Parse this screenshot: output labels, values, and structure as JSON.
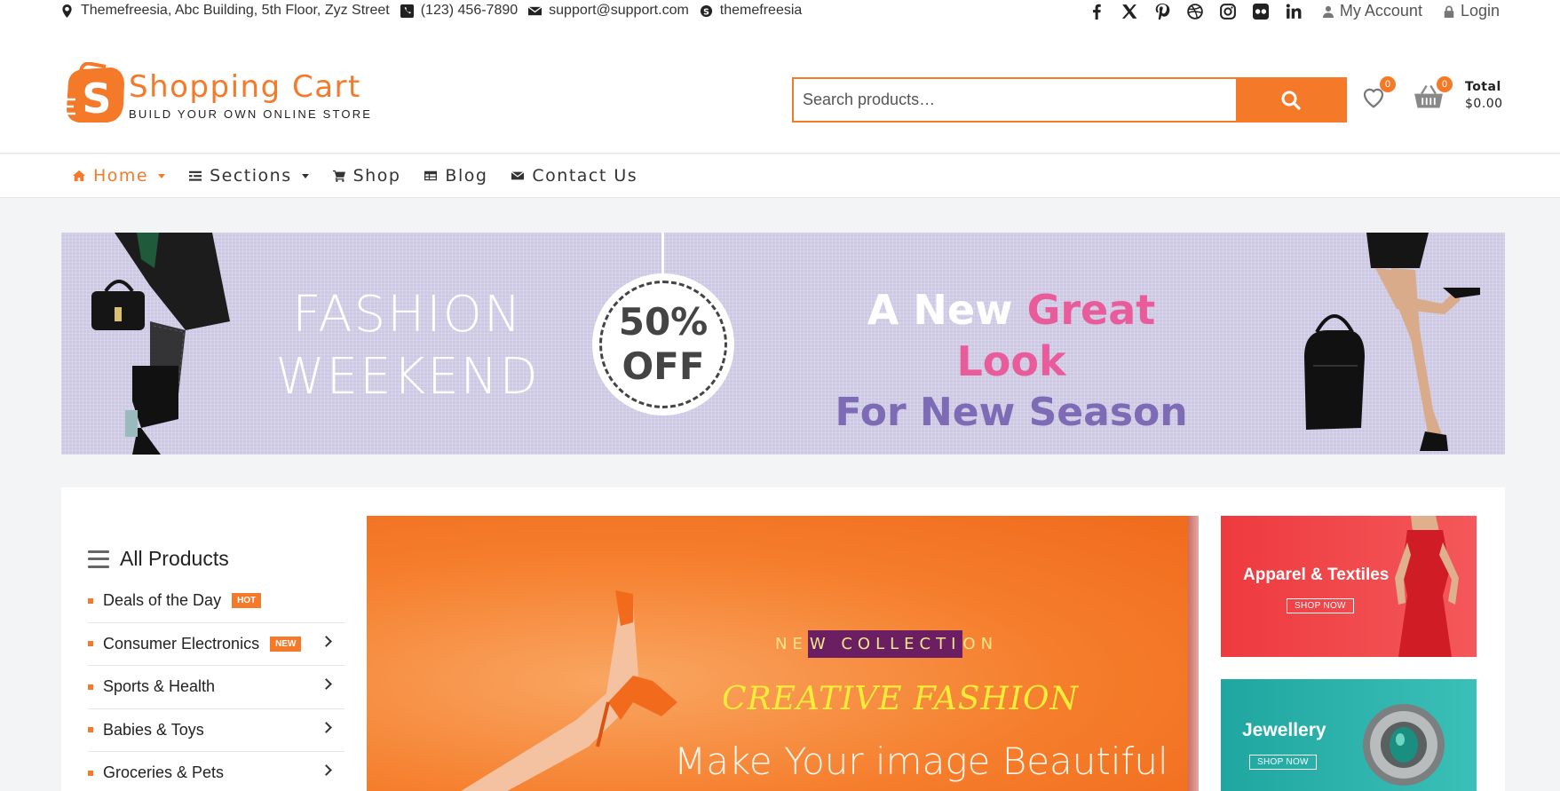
{
  "topbar": {
    "address": "Themefreesia, Abc Building, 5th Floor, Zyz Street",
    "phone": "(123) 456-7890",
    "email": "support@support.com",
    "skype": "themefreesia",
    "social_icons": [
      "facebook-icon",
      "x-twitter-icon",
      "pinterest-icon",
      "dribbble-icon",
      "instagram-icon",
      "flickr-icon",
      "linkedin-icon"
    ],
    "my_account": "My Account",
    "login": "Login"
  },
  "header": {
    "logo_name": "Shopping Cart",
    "logo_tagline": "BUILD YOUR OWN ONLINE STORE",
    "search_placeholder": "Search products…",
    "wishlist_count": "0",
    "cart_count": "0",
    "total_label": "Total",
    "total_value": "$0.00"
  },
  "nav": {
    "items": [
      {
        "label": "Home",
        "active": true,
        "dropdown": true
      },
      {
        "label": "Sections",
        "dropdown": true
      },
      {
        "label": "Shop"
      },
      {
        "label": "Blog"
      },
      {
        "label": "Contact Us"
      }
    ]
  },
  "banner": {
    "left_line1": "FASHION",
    "left_line2": "WEEKEND",
    "discount_line1": "50%",
    "discount_line2": "OFF",
    "headline_white": "A New",
    "headline_pink": "Great Look",
    "headline_line2": "For New Season"
  },
  "categories": {
    "title": "All Products",
    "items": [
      {
        "label": "Deals of the Day",
        "badge": "HOT"
      },
      {
        "label": "Consumer Electronics",
        "badge": "NEW"
      },
      {
        "label": "Sports & Health"
      },
      {
        "label": "Babies & Toys"
      },
      {
        "label": "Groceries & Pets"
      }
    ]
  },
  "slider": {
    "eyebrow_pre": "NE",
    "eyebrow_hl": "W COLLECTI",
    "eyebrow_post": "ON",
    "title": "CREATIVE FASHION",
    "subtitle": "Make Your image Beautiful"
  },
  "promos": [
    {
      "title": "Apparel & Textiles",
      "button": "SHOP NOW"
    },
    {
      "title": "Jewellery",
      "button": "SHOP NOW"
    }
  ],
  "colors": {
    "accent": "#f47a2a",
    "banner_bg": "#cdc8e3",
    "promo_red": "#ee3a3f",
    "promo_teal": "#1fa6a0"
  }
}
